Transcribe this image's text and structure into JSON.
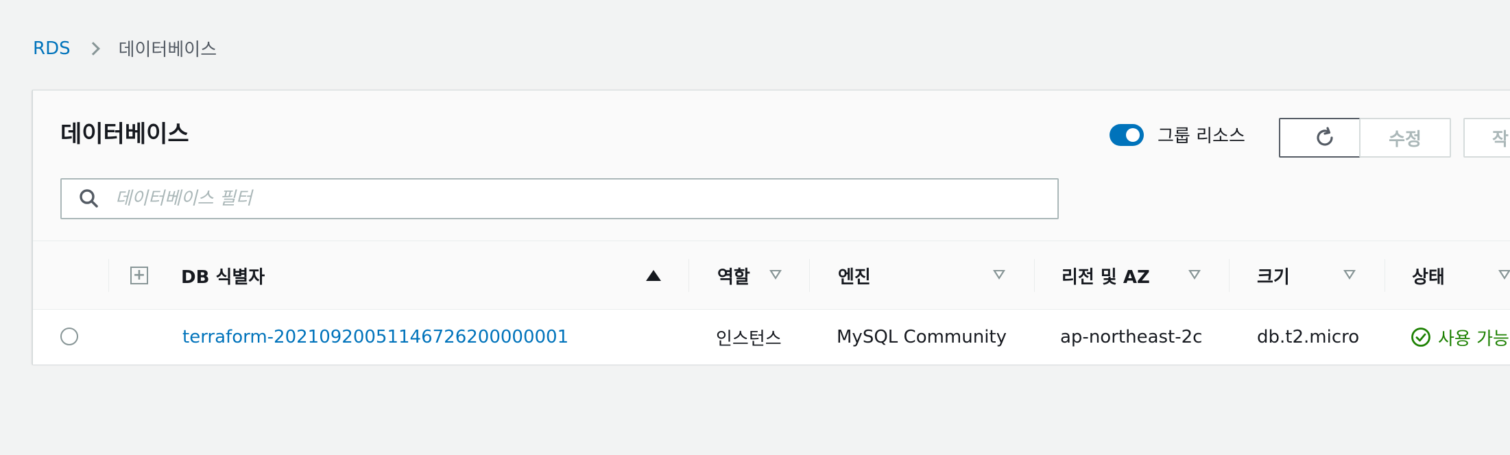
{
  "breadcrumb": {
    "root": "RDS",
    "current": "데이터베이스"
  },
  "panel": {
    "title": "데이터베이스",
    "group_toggle_label": "그룹 리소스",
    "group_toggle_on": true,
    "refresh_icon": "refresh-icon",
    "edit_label": "수정",
    "actions_label": "작"
  },
  "search": {
    "placeholder": "데이터베이스 필터",
    "icon": "search-icon"
  },
  "table": {
    "columns": [
      {
        "label": "DB 식별자",
        "sort": "ascending"
      },
      {
        "label": "역할"
      },
      {
        "label": "엔진"
      },
      {
        "label": "리전 및 AZ"
      },
      {
        "label": "크기"
      },
      {
        "label": "상태"
      }
    ],
    "rows": [
      {
        "identifier": "terraform-20210920051146726200000001",
        "role": "인스턴스",
        "engine": "MySQL Community",
        "region_az": "ap-northeast-2c",
        "size": "db.t2.micro",
        "status": "사용 가능"
      }
    ]
  },
  "colors": {
    "link": "#0073bb",
    "status_available": "#1d8102",
    "toggle_on": "#0073bb"
  }
}
